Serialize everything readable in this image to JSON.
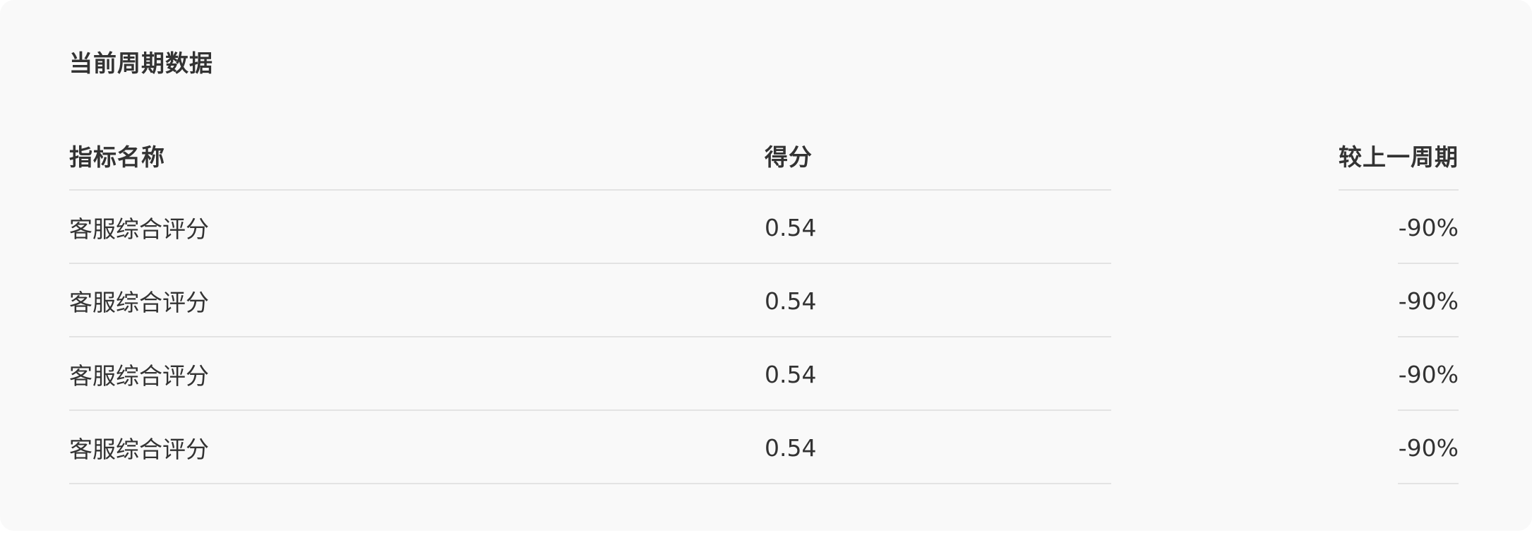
{
  "card": {
    "title": "当前周期数据"
  },
  "table": {
    "columns": [
      "指标名称",
      "得分",
      "较上一周期"
    ],
    "rows": [
      {
        "name": "客服综合评分",
        "score": "0.54",
        "change": "-90%"
      },
      {
        "name": "客服综合评分",
        "score": "0.54",
        "change": "-90%"
      },
      {
        "name": "客服综合评分",
        "score": "0.54",
        "change": "-90%"
      },
      {
        "name": "客服综合评分",
        "score": "0.54",
        "change": "-90%"
      }
    ]
  }
}
